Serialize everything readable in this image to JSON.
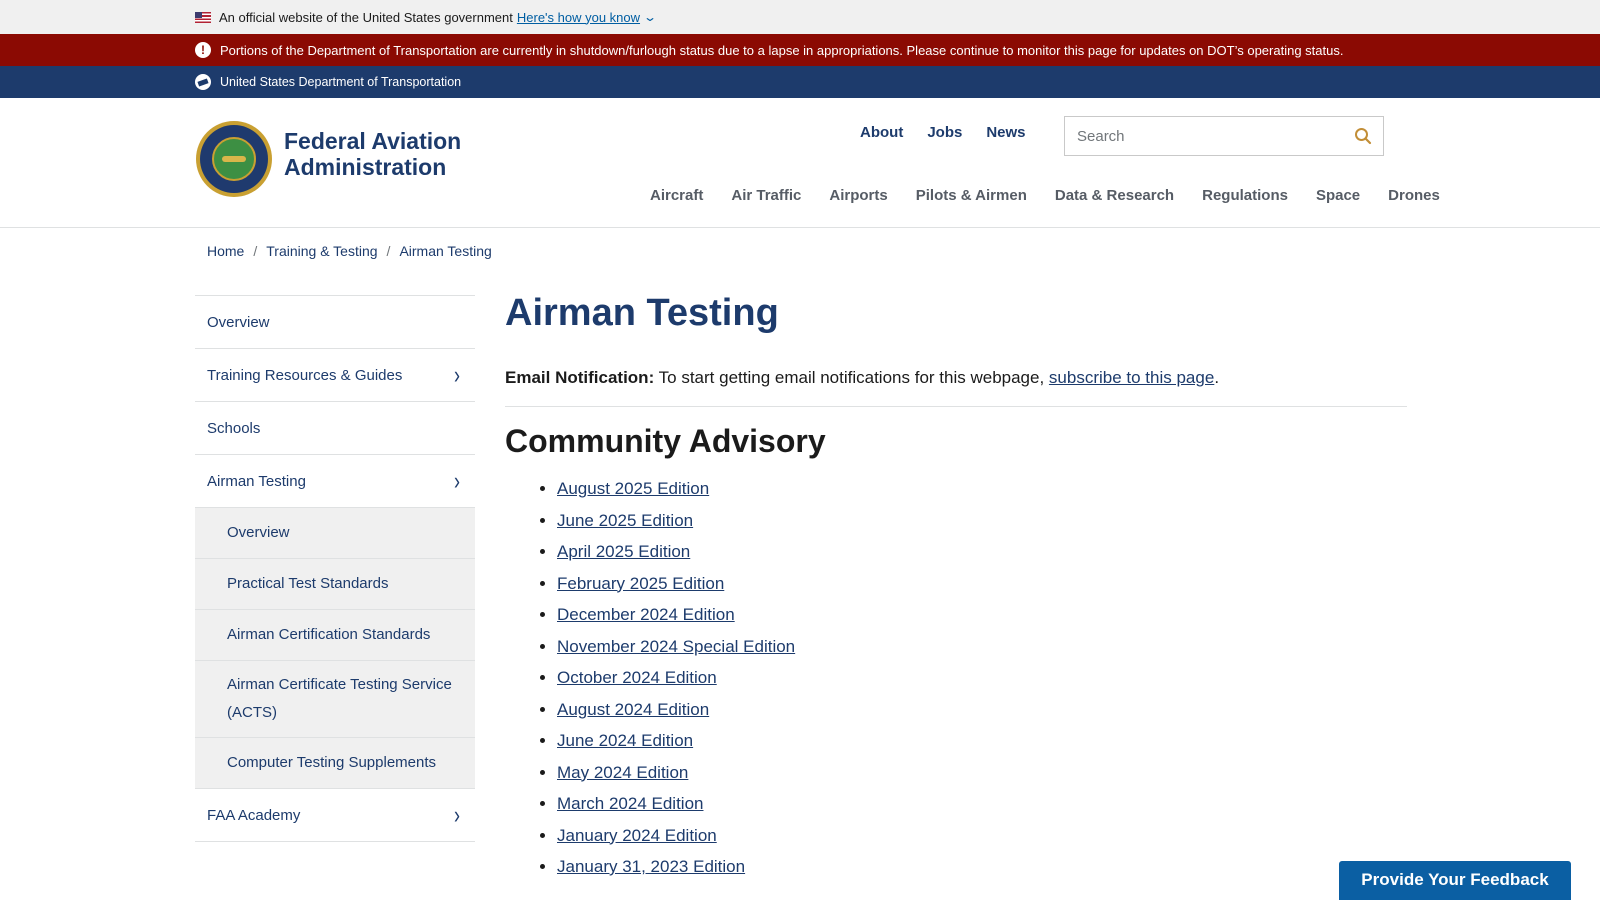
{
  "gov_banner": {
    "text": "An official website of the United States government",
    "link": "Here's how you know"
  },
  "alert": {
    "text": "Portions of the Department of Transportation are currently in shutdown/furlough status due to a lapse in appropriations. Please continue to monitor this page for updates on DOT’s operating status."
  },
  "dot_bar": {
    "text": "United States Department of Transportation"
  },
  "header": {
    "site_name_line1": "Federal Aviation",
    "site_name_line2": "Administration",
    "utility_nav": [
      "About",
      "Jobs",
      "News"
    ],
    "search_placeholder": "Search",
    "main_nav": [
      "Aircraft",
      "Air Traffic",
      "Airports",
      "Pilots & Airmen",
      "Data & Research",
      "Regulations",
      "Space",
      "Drones"
    ]
  },
  "breadcrumb": [
    "Home",
    "Training & Testing",
    "Airman Testing"
  ],
  "sidenav": {
    "items": [
      "Overview",
      "Training Resources & Guides",
      "Schools",
      "Airman Testing",
      "FAA Academy"
    ],
    "sub_items": [
      "Overview",
      "Practical Test Standards",
      "Airman Certification Standards",
      "Airman Certificate Testing Service (ACTS)",
      "Computer Testing Supplements"
    ]
  },
  "content": {
    "title": "Airman Testing",
    "email_label": "Email Notification:",
    "email_text": " To start getting email notifications for this webpage, ",
    "email_link": "subscribe to this page",
    "email_end": ".",
    "section_title": "Community Advisory",
    "editions": [
      "August 2025 Edition",
      "June 2025 Edition",
      "April 2025 Edition",
      "February 2025 Edition",
      "December 2024 Edition",
      "November 2024 Special Edition",
      "October 2024 Edition",
      "August 2024 Edition",
      "June 2024 Edition",
      "May 2024 Edition",
      "March 2024 Edition",
      "January 2024 Edition",
      "January 31, 2023 Edition"
    ]
  },
  "feedback_button": "Provide Your Feedback",
  "colors": {
    "navy": "#1d3b6c",
    "alert_red": "#8b0a03",
    "link_blue": "#005ea2",
    "feedback_blue": "#0b5fa3"
  }
}
